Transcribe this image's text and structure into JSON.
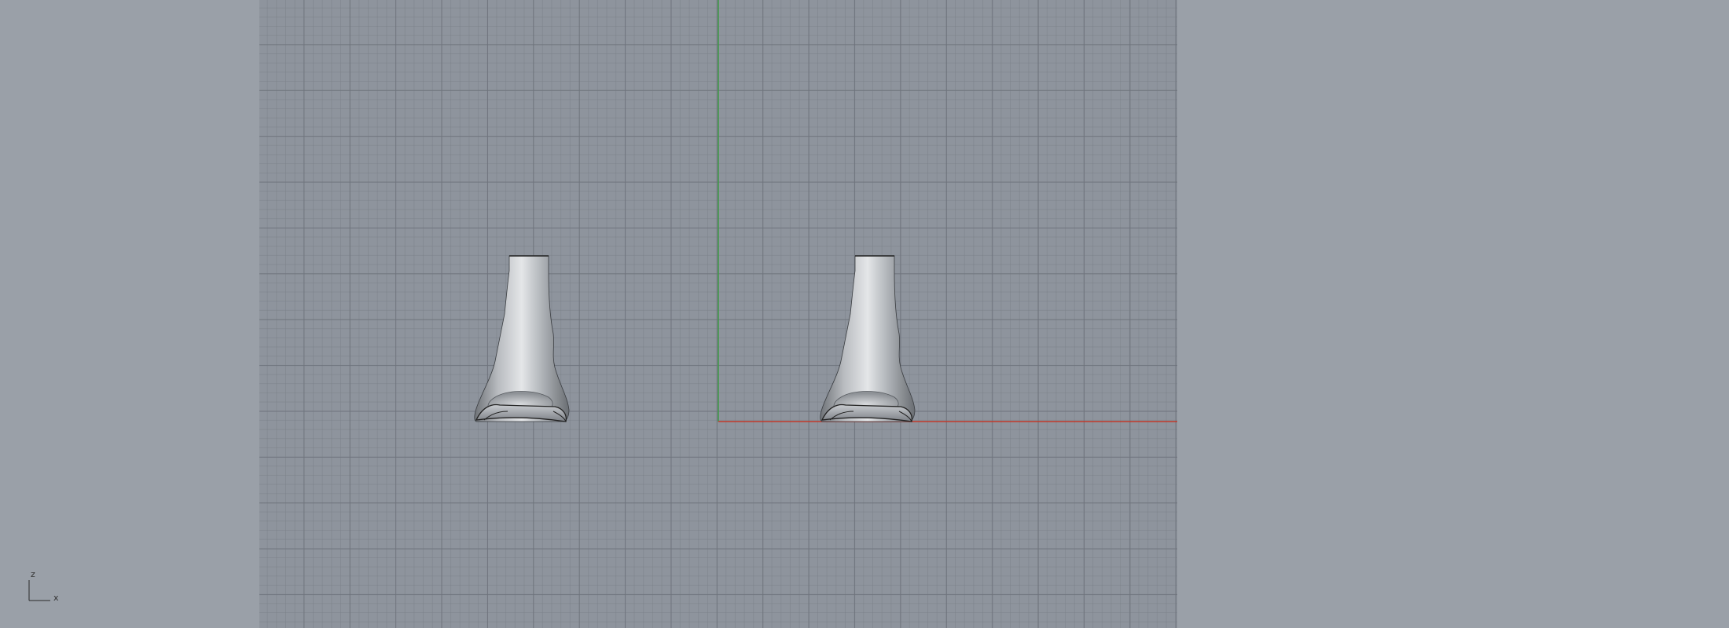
{
  "viewport": {
    "background_color": "#9aa0a8",
    "grid_color": "#8e949d",
    "x_axis_color": "#c0392b",
    "y_axis_color": "#3c9a45"
  },
  "axis_indicator": {
    "vertical_label": "z",
    "horizontal_label": "x"
  },
  "objects": [
    {
      "name": "left-boot-model"
    },
    {
      "name": "right-boot-model"
    }
  ]
}
